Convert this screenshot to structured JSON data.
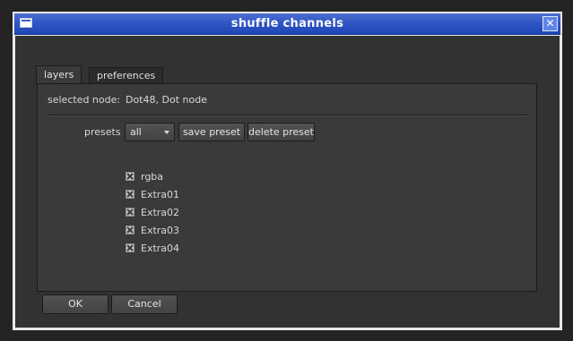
{
  "window": {
    "title": "shuffle channels",
    "close_glyph": "✕",
    "close_icon": "close-icon",
    "menu_icon": "window-menu-icon"
  },
  "tabs": [
    {
      "label": "layers",
      "active": true
    },
    {
      "label": "preferences",
      "active": false
    }
  ],
  "node": {
    "label": "selected node:",
    "value": "Dot48, Dot node"
  },
  "presets": {
    "label": "presets",
    "selected": "all",
    "save_label": "save preset",
    "delete_label": "delete preset"
  },
  "layers": [
    {
      "name": "rgba",
      "checked": true
    },
    {
      "name": "Extra01",
      "checked": true
    },
    {
      "name": "Extra02",
      "checked": true
    },
    {
      "name": "Extra03",
      "checked": true
    },
    {
      "name": "Extra04",
      "checked": true
    }
  ],
  "footer": {
    "ok_label": "OK",
    "cancel_label": "Cancel"
  },
  "colors": {
    "titlebar": "#2f56c4",
    "panel": "#3a3a3a",
    "background": "#323232"
  }
}
